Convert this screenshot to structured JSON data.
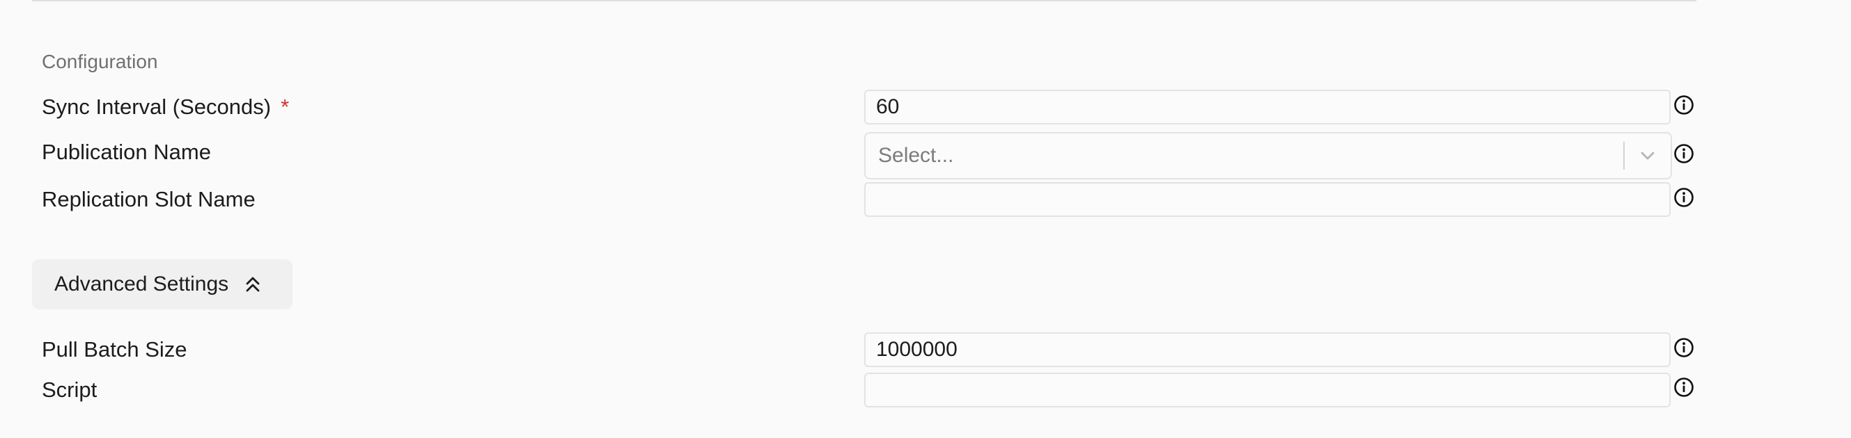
{
  "configuration": {
    "heading": "Configuration",
    "sync_interval": {
      "label": "Sync Interval (Seconds)",
      "required_mark": "*",
      "value": "60"
    },
    "publication_name": {
      "label": "Publication Name",
      "placeholder": "Select..."
    },
    "replication_slot_name": {
      "label": "Replication Slot Name",
      "value": ""
    }
  },
  "advanced": {
    "toggle_label": "Advanced Settings",
    "toggle_icon": "chevrons-up-icon",
    "pull_batch_size": {
      "label": "Pull Batch Size",
      "value": "1000000"
    },
    "script": {
      "label": "Script",
      "value": ""
    }
  },
  "icons": {
    "info": "info-circle-icon",
    "dropdown": "chevron-down-icon"
  },
  "colors": {
    "required": "#d0312d",
    "heading": "#707070",
    "field_border": "#e3e3e3"
  }
}
